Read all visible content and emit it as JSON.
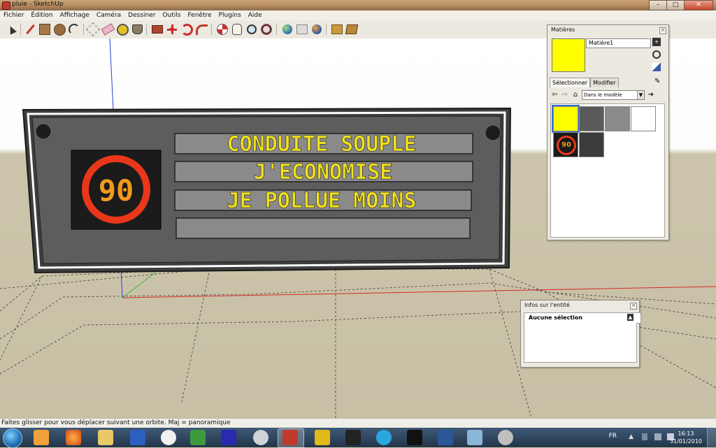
{
  "window": {
    "title": "pluie - SketchUp",
    "minimize": "–",
    "maximize": "□",
    "close": "✕"
  },
  "menu": [
    "Fichier",
    "Édition",
    "Affichage",
    "Caméra",
    "Dessiner",
    "Outils",
    "Fenêtre",
    "Plugins",
    "Aide"
  ],
  "toolbar_icons": [
    "select-icon",
    "pencil-line-icon",
    "rectangle-icon",
    "circle-icon",
    "arc-icon",
    "make-component-icon",
    "eraser-icon",
    "tape-measure-icon",
    "paint-bucket-icon",
    "push-pull-icon",
    "move-icon",
    "rotate-icon",
    "follow-me-icon",
    "orbit-icon",
    "pan-icon",
    "zoom-icon",
    "zoom-extents-icon",
    "google-earth-icon",
    "add-location-icon",
    "toggle-terrain-icon",
    "get-models-icon",
    "share-model-icon"
  ],
  "scene": {
    "sign_lines": [
      "CONDUITE SOUPLE",
      "J'ECONOMISE",
      "JE POLLUE MOINS",
      ""
    ],
    "speed_limit": "90",
    "led_color": "#f1e11d"
  },
  "materials_panel": {
    "title": "Matières",
    "current_material": "Matière1",
    "tabs": [
      "Sélectionner",
      "Modifier"
    ],
    "library": "Dans le modèle",
    "swatches": [
      {
        "name": "yellow",
        "color": "#ffff00"
      },
      {
        "name": "dark-gray",
        "color": "#5a5a5a"
      },
      {
        "name": "gray",
        "color": "#8a8a8a"
      },
      {
        "name": "white",
        "color": "#ffffff"
      },
      {
        "name": "speed-sign-texture",
        "color": "#1a1a1a"
      },
      {
        "name": "charcoal",
        "color": "#3c3c3c"
      }
    ]
  },
  "entity_panel": {
    "title": "Infos sur l'entité",
    "selection": "Aucune sélection"
  },
  "status": {
    "text": "Faites glisser pour vous déplacer suivant une orbite.  Maj = panoramique"
  },
  "taskbar": {
    "language": "FR",
    "time": "16:13",
    "date": "31/01/2010"
  }
}
